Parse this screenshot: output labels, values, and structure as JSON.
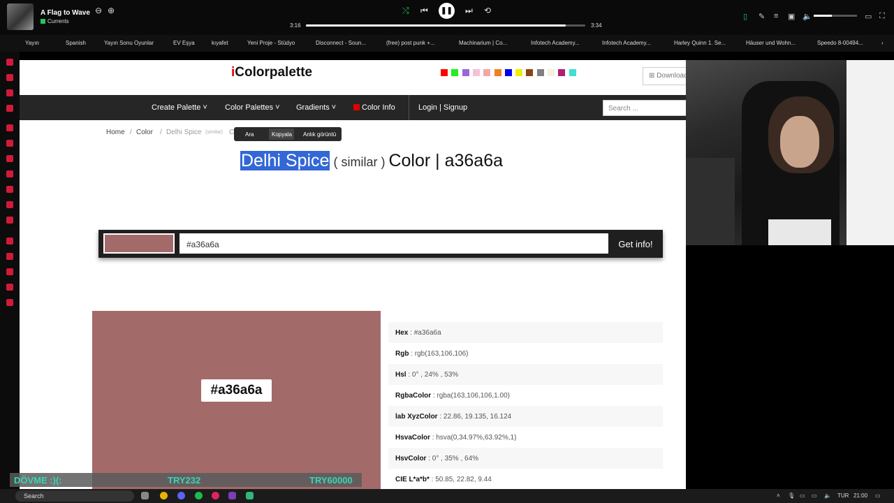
{
  "player": {
    "song": "A Flag to Wave",
    "artist": "Currents",
    "elapsed": "3:16",
    "total": "3:34",
    "progress": 0.93,
    "volume": 0.42
  },
  "bookmarks": [
    "Yayın",
    "Spanish",
    "Yayın Sonu Oyunlar",
    "EV Eşya",
    "kıyafet",
    "Yeni Proje - Stüdyo",
    "Disconnect - Soun...",
    "(free) post punk +...",
    "Machinarium | Co...",
    "Infotech Academy...",
    "Infotech Academy...",
    "Harley Quinn 1. Se...",
    "Häuser und Wohn...",
    "Speedo 8-00494..."
  ],
  "site": {
    "logo_i": "i",
    "logo_rest": "Colorpalette",
    "swatches": [
      "#ff0000",
      "#22ee22",
      "#9966dd",
      "#f4c2d6",
      "#f4a6a6",
      "#f08020",
      "#0000ee",
      "#eeee00",
      "#8b4513",
      "#808080",
      "#f5f0e0",
      "#b0206e",
      "#40e0d0"
    ],
    "download": "Download",
    "nav": {
      "create": "Create Palette ˅",
      "palettes": "Color Palettes ˅",
      "gradients": "Gradients ˅",
      "info": "Color Info",
      "login": "Login | Signup",
      "search_placeholder": "Search ..."
    },
    "breadcrumb": {
      "home": "Home",
      "sep": "/",
      "color": "Color",
      "current": "Delhi Spice",
      "similar": "(similar)",
      "tail": "C"
    },
    "context_menu": {
      "search": "Ara",
      "copy": "Kopyala",
      "screenshot": "Anlık görüntü"
    },
    "heading": {
      "name": "Delhi Spice",
      "similar": "( similar )",
      "rest": "Color | a36a6a"
    },
    "input_value": "#a36a6a",
    "get_info": "Get info!",
    "color_label": "#a36a6a",
    "info_rows": [
      {
        "key": "Hex",
        "value": " : #a36a6a"
      },
      {
        "key": "Rgb",
        "value": " : rgb(163,106,106)"
      },
      {
        "key": "Hsl",
        "value": " : 0° , 24% , 53%"
      },
      {
        "key": "RgbaColor",
        "value": " : rgba(163,106,106,1.00)"
      },
      {
        "key": "lab XyzColor",
        "value": " : 22.86, 19.135, 16.124"
      },
      {
        "key": "HsvaColor",
        "value": " : hsva(0,34.97%,63.92%,1)"
      },
      {
        "key": "HsvColor",
        "value": " : 0° , 35% , 64%"
      },
      {
        "key": "CIE L*a*b*",
        "value": " : 50.85, 22.82, 9.44"
      }
    ]
  },
  "overlay": {
    "left": "DÖVME :)(:",
    "mid": "TRY232",
    "right": "TRY60000"
  },
  "taskbar": {
    "search": "Search",
    "lang": "TUR",
    "clock": "21:00"
  }
}
